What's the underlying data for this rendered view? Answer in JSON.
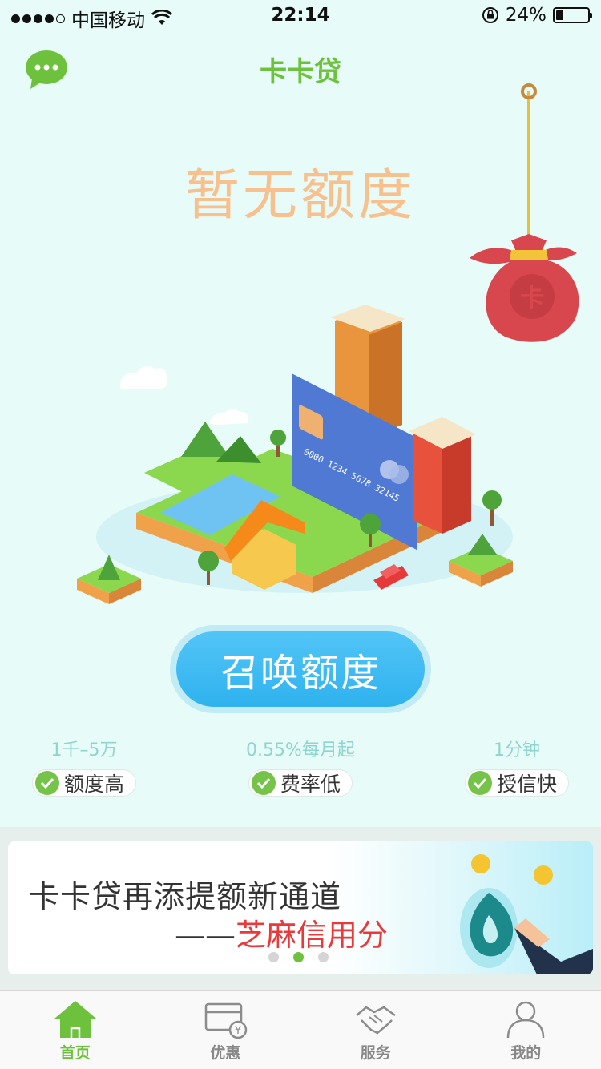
{
  "status_bar": {
    "carrier": "中国移动",
    "time": "22:14",
    "battery": "24%",
    "battery_level": 0.24
  },
  "header": {
    "title": "卡卡贷"
  },
  "hero": {
    "quota_status": "暂无额度",
    "card_number": "0000 1234 5678 32145",
    "cta_label": "召唤额度"
  },
  "features": [
    {
      "value": "1千–5万",
      "label": "额度高"
    },
    {
      "value": "0.55%每月起",
      "label": "费率低"
    },
    {
      "value": "1分钟",
      "label": "授信快"
    }
  ],
  "banner": {
    "line1": "卡卡贷再添提额新通道",
    "line2_prefix": "——",
    "line2_highlight": "芝麻信用分",
    "active_slide": 2,
    "slide_count": 3
  },
  "tabs": [
    {
      "label": "首页",
      "icon": "home-icon",
      "active": true
    },
    {
      "label": "优惠",
      "icon": "coupon-icon",
      "active": false
    },
    {
      "label": "服务",
      "icon": "handshake-icon",
      "active": false
    },
    {
      "label": "我的",
      "icon": "user-icon",
      "active": false
    }
  ],
  "colors": {
    "brand_green": "#6dc13c",
    "cta_blue": "#2fb2ee",
    "quota_orange": "#f8c08d",
    "highlight_red": "#e83a3a",
    "hero_bg": "#e7fbf8"
  }
}
